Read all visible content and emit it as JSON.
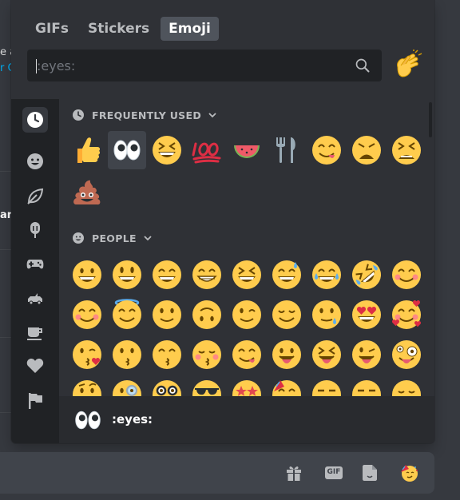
{
  "background": {
    "fragments": [
      "e a",
      "r C",
      "an"
    ]
  },
  "tabs": [
    {
      "label": "GIFs",
      "active": false
    },
    {
      "label": "Stickers",
      "active": false
    },
    {
      "label": "Emoji",
      "active": true
    }
  ],
  "search": {
    "placeholder": ":eyes:",
    "value": ""
  },
  "categories": [
    {
      "label": "FREQUENTLY USED",
      "icon": "clock-icon"
    },
    {
      "label": "PEOPLE",
      "icon": "smiley-icon"
    }
  ],
  "sidebar_icons": [
    "clock-icon",
    "smiley-icon",
    "leaf-icon",
    "popsicle-icon",
    "gamepad-icon",
    "car-icon",
    "coffee-icon",
    "heart-icon",
    "flag-icon"
  ],
  "frequently_used": [
    "thumbs-up",
    "eyes",
    "laughing",
    "hundred",
    "watermelon",
    "fork-knife",
    "yum",
    "weary",
    "tired-face",
    "poop"
  ],
  "people": [
    "grinning",
    "smiley",
    "smile",
    "grin",
    "laughing",
    "sweat-smile",
    "joy",
    "rofl",
    "relaxed",
    "blush",
    "innocent",
    "slight-smile",
    "upside-down",
    "wink",
    "relieved",
    "sweat-drop",
    "heart-eyes",
    "smiling-hearts",
    "kissing-heart",
    "kissing",
    "kissing-smile",
    "kissing-closed",
    "yum",
    "tongue",
    "squint-tongue",
    "wink-tongue",
    "zany",
    "raised-brow",
    "monocle",
    "nerd",
    "sunglasses",
    "star-struck",
    "partying",
    "smirk",
    "unamused",
    "disappointed"
  ],
  "footer": {
    "emoji": "eyes",
    "name": ":eyes:"
  },
  "chat_buttons": [
    "gift-icon",
    "gif-icon",
    "sticker-icon",
    "emoji-icon"
  ],
  "chat_gif_label": "GIF",
  "colors": {
    "picker_bg": "#2f3136",
    "sidebar_bg": "#202225",
    "footer_bg": "#292b2f",
    "emoji_yellow": "#ffcc4d"
  }
}
